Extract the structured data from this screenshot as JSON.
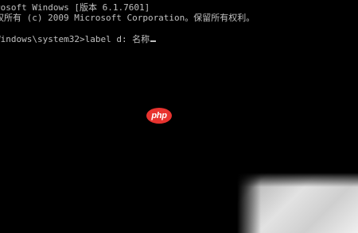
{
  "console": {
    "lines": [
      "rosoft Windows [版本 6.1.7601]",
      "权所有 (c) 2009 Microsoft Corporation。保留所有权利。",
      "Windows\\system32>label d: 名称"
    ]
  },
  "watermark": {
    "text": "php",
    "color": "#e8332f"
  },
  "colors": {
    "background": "#000000",
    "text": "#c0c0c0"
  }
}
